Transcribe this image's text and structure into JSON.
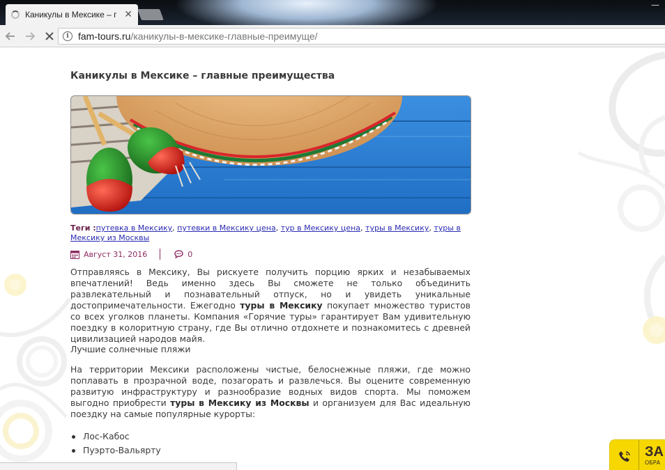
{
  "browser": {
    "tab_title": "Каникулы в Мексике – г",
    "url_host": "fam-tours.ru",
    "url_path": "/каникулы-в-мексике-главные-преимуще/"
  },
  "article": {
    "title": "Каникулы в Мексике – главные преимущества",
    "tags_label": "Теги :",
    "tags": [
      "путевка в Мексику",
      "путевки в Мексику цена",
      "тур в Мексику цена",
      "туры в Мексику",
      "туры в Мексику из Москвы"
    ],
    "date": "Август 31, 2016",
    "comments": "0",
    "p1_a": "Отправляясь в Мексику, Вы рискуете получить порцию ярких и незабываемых впечатлений! Ведь именно здесь Вы сможете не только объединить развлекательный и познавательный отпуск, но и увидеть уникальные достопримечательности. Ежегодно ",
    "p1_b": "туры в Мексику",
    "p1_c": " покупает множество туристов со всех уголков планеты. Компания «Горячие туры» гарантирует Вам удивительную поездку в колоритную страну, где Вы отлично отдохнете и познакомитесь с древней цивилизацией народов майя.",
    "heading_beaches": "Лучшие солнечные пляжи",
    "p2_a": "На территории Мексики расположены чистые, белоснежные пляжи, где можно поплавать в прозрачной воде, позагорать и развлечься. Вы оцените современную развитую инфраструктуру и разнообразие водных видов спорта. Мы поможем выгодно приобрести ",
    "p2_b": "туры в Мексику из Москвы",
    "p2_c": " и организуем для Вас идеальную поездку на самые популярные курорты:",
    "resorts": [
      "Лос-Кабос",
      "Пуэрто-Вальярту"
    ]
  },
  "callback": {
    "title": "ЗА",
    "sub": "ОБРА"
  },
  "colors": {
    "accent": "#8d2b62",
    "link": "#2b2bb3",
    "callback_bg": "#f6d800"
  }
}
